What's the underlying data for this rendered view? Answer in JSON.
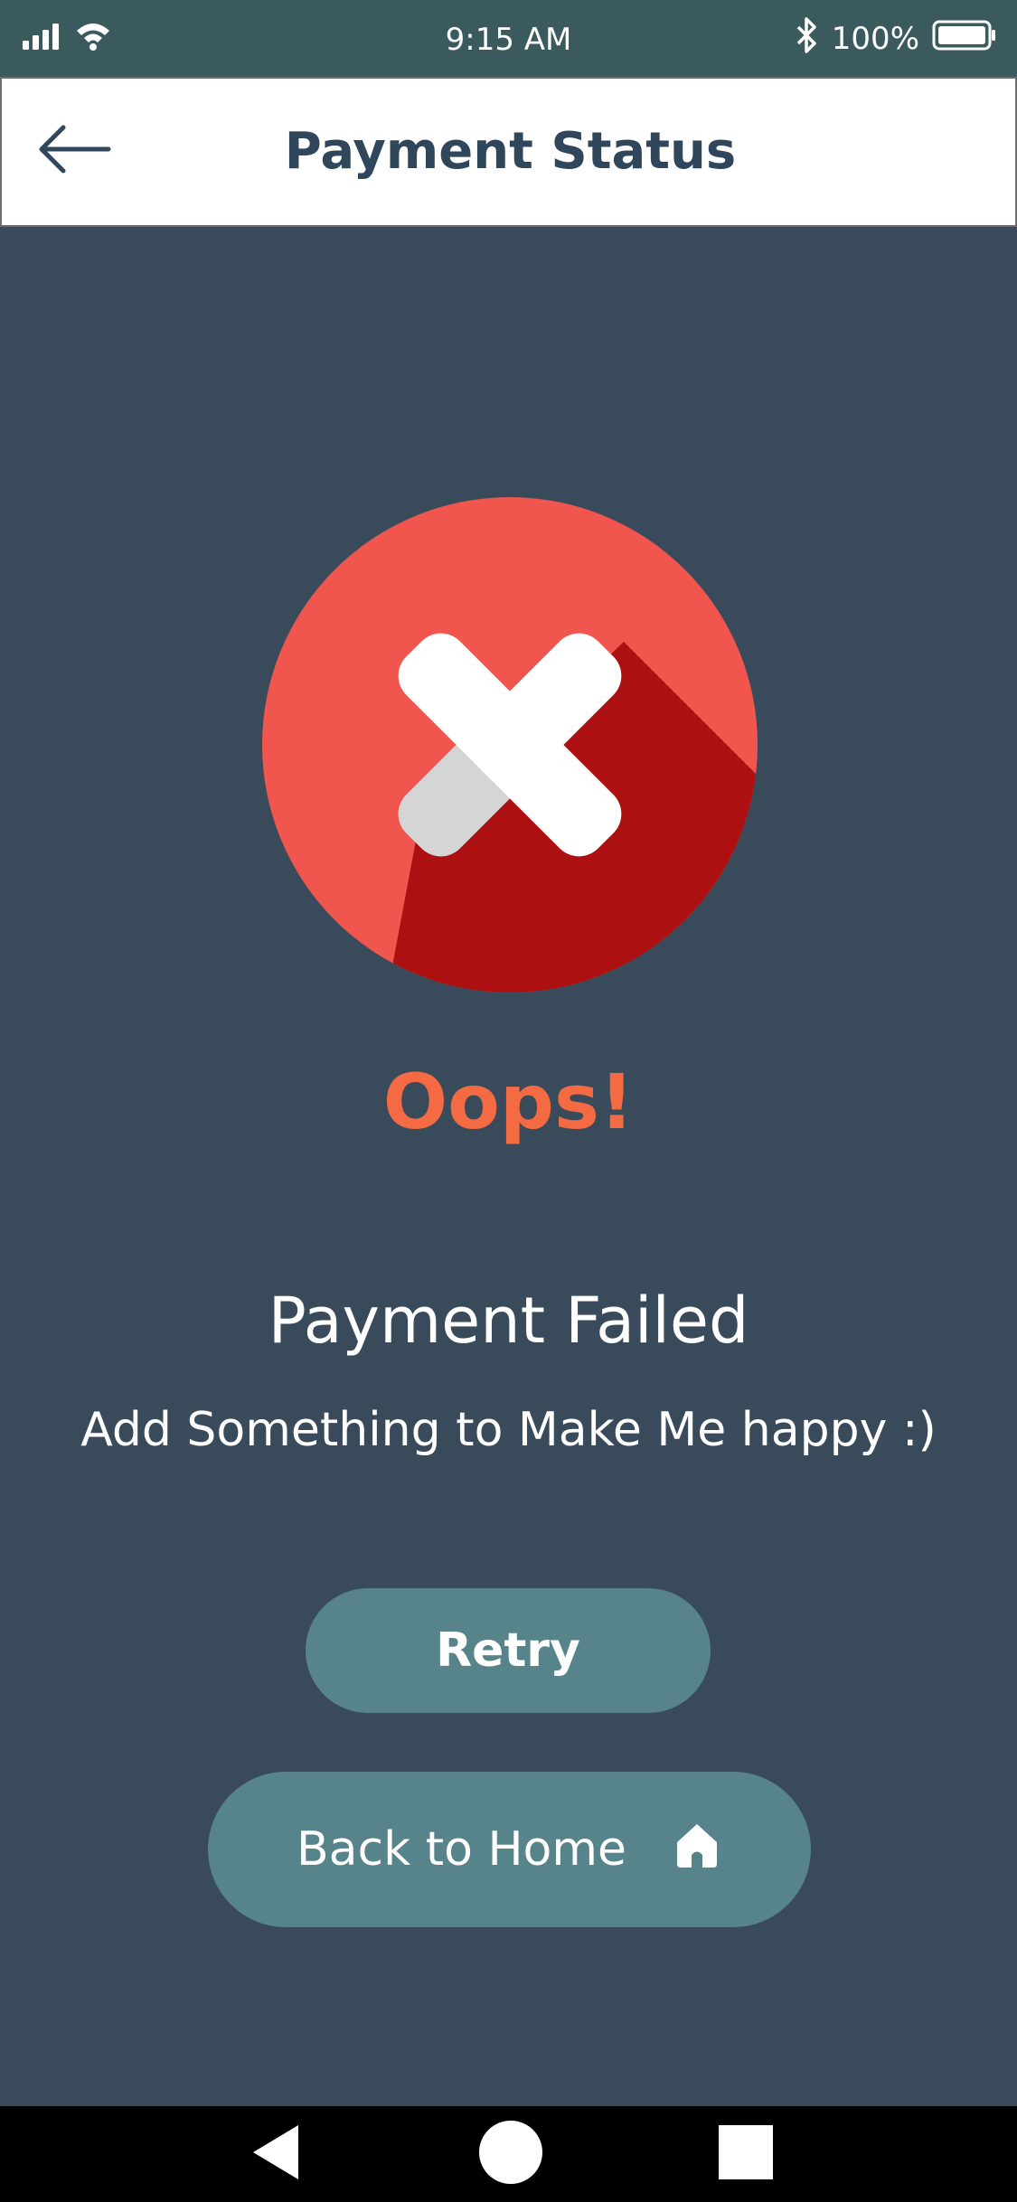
{
  "status_bar": {
    "time": "9:15 AM",
    "battery_text": "100%",
    "icons": [
      "signal-icon",
      "wifi-icon",
      "bluetooth-icon",
      "battery-icon"
    ]
  },
  "header": {
    "title": "Payment Status",
    "back_icon": "arrow-left-icon"
  },
  "main": {
    "status_icon": "error-x-icon",
    "oops_text": "Oops!",
    "title": "Payment Failed",
    "subtitle": "Add Something to Make Me happy :)",
    "retry_label": "Retry",
    "home_label": "Back to Home",
    "home_icon": "home-icon"
  },
  "nav_bar": {
    "icons": [
      "nav-back-icon",
      "nav-home-icon",
      "nav-recents-icon"
    ]
  },
  "colors": {
    "status_bar_bg": "#3a5a5e",
    "page_bg": "#394b5a",
    "header_title": "#30465a",
    "error_red": "#f1564e",
    "error_dark_red": "#ad1010",
    "oops_orange": "#f36a43",
    "button_teal": "#57838a"
  }
}
